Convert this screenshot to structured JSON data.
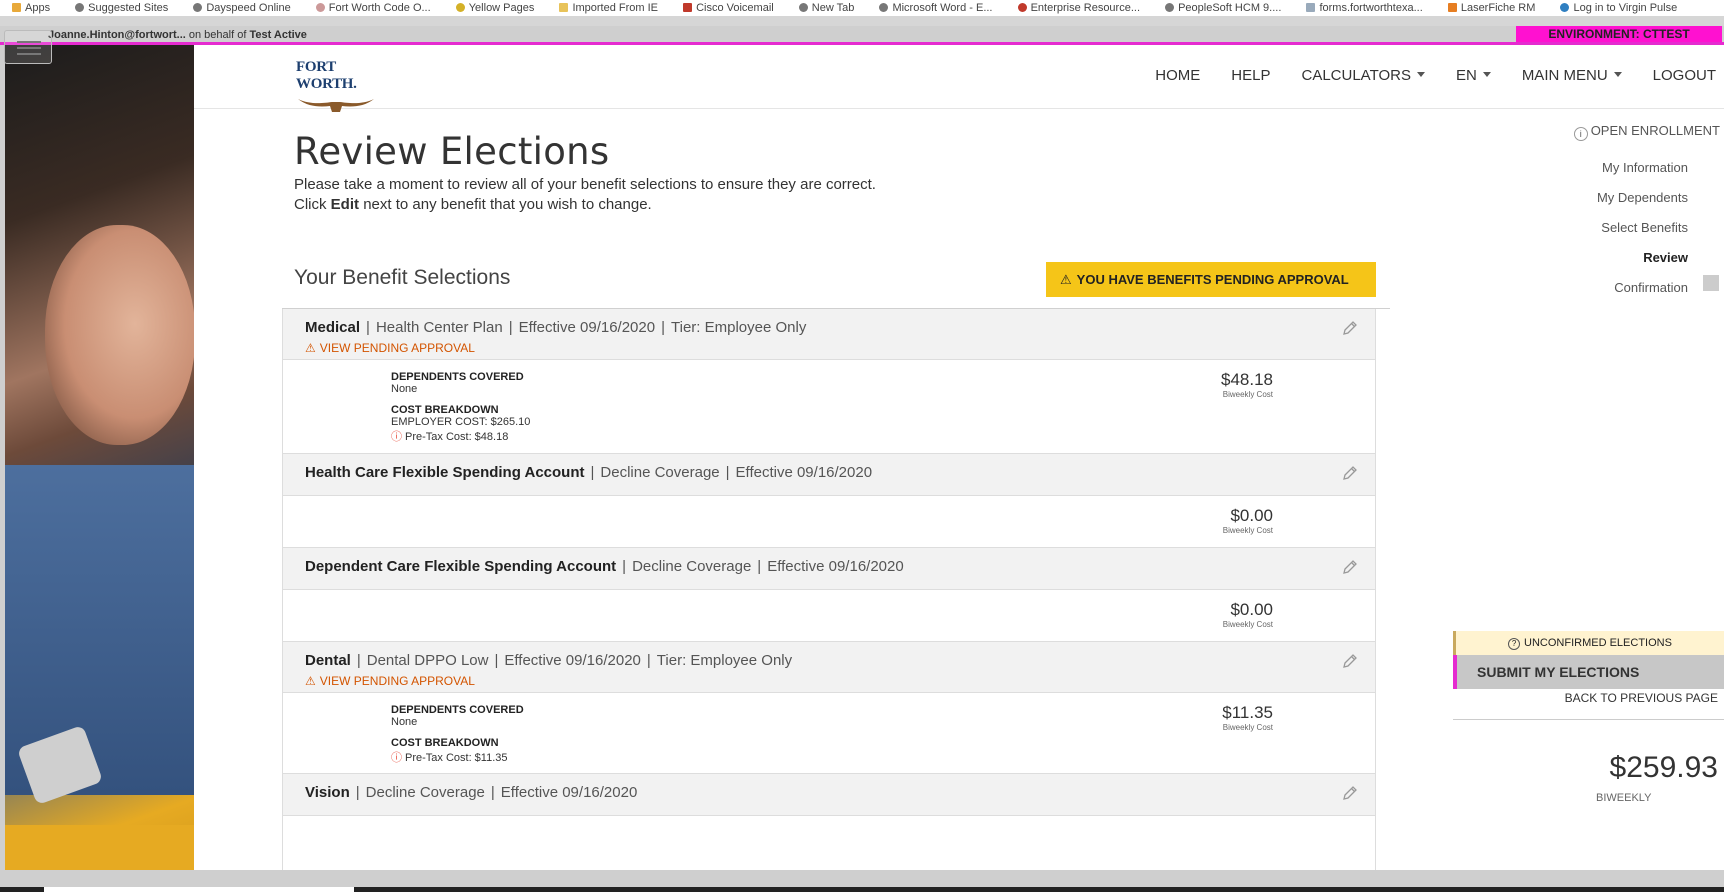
{
  "bookmarks": [
    "Apps",
    "Suggested Sites",
    "Dayspeed Online",
    "Fort Worth Code O...",
    "Yellow Pages",
    "Imported From IE",
    "Cisco Voicemail",
    "New Tab",
    "Microsoft Word - E...",
    "Enterprise Resource...",
    "PeopleSoft HCM 9....",
    "forms.fortworthtexa...",
    "LaserFiche RM",
    "Log in to Virgin Pulse"
  ],
  "userbar": {
    "user": "Joanne.Hinton@fortwort...",
    "on_behalf_prefix": "on behalf of",
    "on_behalf_name": "Test Active",
    "environment": "ENVIRONMENT: CTTEST"
  },
  "logo": {
    "text": "FORT WORTH."
  },
  "nav": {
    "home": "HOME",
    "help": "HELP",
    "calculators": "CALCULATORS",
    "lang": "EN",
    "main_menu": "MAIN MENU",
    "logout": "LOGOUT"
  },
  "page": {
    "title": "Review Elections",
    "intro1": "Please take a moment to review all of your benefit selections to ensure they are correct.",
    "intro2_prefix": "Click",
    "intro2_edit": "Edit",
    "intro2_suffix": "next to any benefit that you wish to change.",
    "selections_title": "Your Benefit Selections",
    "pending_banner": "YOU HAVE BENEFITS PENDING APPROVAL"
  },
  "benefits": [
    {
      "name": "Medical",
      "plan": "Health Center Plan",
      "effective": "Effective 09/16/2020",
      "tier": "Tier: Employee Only",
      "pending": "VIEW PENDING APPROVAL",
      "dependents_label": "DEPENDENTS COVERED",
      "dependents_value": "None",
      "cost_label": "COST BREAKDOWN",
      "employer_cost": "EMPLOYER COST: $265.10",
      "pretax_cost": "Pre-Tax Cost: $48.18",
      "amount": "$48.18",
      "freq": "Biweekly Cost"
    },
    {
      "name": "Health Care Flexible Spending Account",
      "plan": "Decline Coverage",
      "effective": "Effective 09/16/2020",
      "amount": "$0.00",
      "freq": "Biweekly Cost"
    },
    {
      "name": "Dependent Care Flexible Spending Account",
      "plan": "Decline Coverage",
      "effective": "Effective 09/16/2020",
      "amount": "$0.00",
      "freq": "Biweekly Cost"
    },
    {
      "name": "Dental",
      "plan": "Dental DPPO Low",
      "effective": "Effective 09/16/2020",
      "tier": "Tier: Employee Only",
      "pending": "VIEW PENDING APPROVAL",
      "dependents_label": "DEPENDENTS COVERED",
      "dependents_value": "None",
      "cost_label": "COST BREAKDOWN",
      "pretax_cost": "Pre-Tax Cost: $11.35",
      "amount": "$11.35",
      "freq": "Biweekly Cost"
    },
    {
      "name": "Vision",
      "plan": "Decline Coverage",
      "effective": "Effective 09/16/2020"
    }
  ],
  "sidebar": {
    "open_enrollment": "OPEN ENROLLMENT",
    "steps": [
      "My Information",
      "My Dependents",
      "Select Benefits",
      "Review",
      "Confirmation"
    ],
    "active_step": "Review",
    "unconfirmed": "UNCONFIRMED ELECTIONS",
    "submit": "SUBMIT MY ELECTIONS",
    "back": "BACK TO PREVIOUS PAGE",
    "total": "$259.93",
    "total_freq": "BIWEEKLY"
  },
  "colors": {
    "accent_magenta": "#e52bd0",
    "banner_yellow": "#f5c518",
    "pending_orange": "#d35400",
    "navy_logo": "#1d3f6f"
  }
}
